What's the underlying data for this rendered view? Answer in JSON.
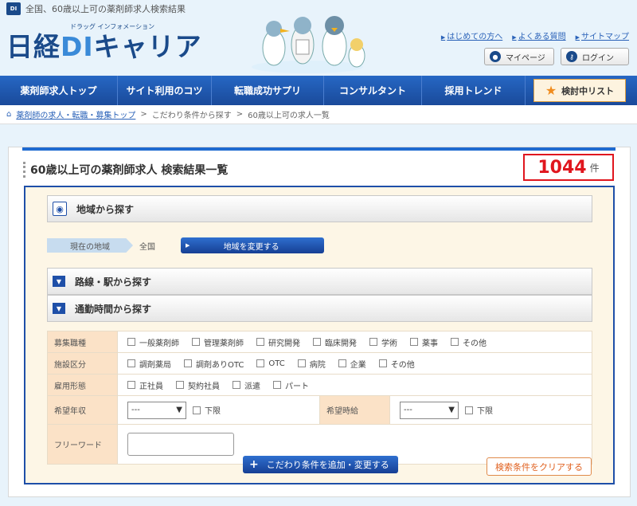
{
  "top": {
    "badge": "DI",
    "tagline": "全国、60歳以上可の薬剤師求人検索結果"
  },
  "brand": {
    "sub": "ドラッグ インフォメーション",
    "name_a": "日経",
    "name_b": "DI",
    "name_c": "キャリア"
  },
  "head_links": [
    "はじめての方へ",
    "よくある質問",
    "サイトマップ"
  ],
  "head_buttons": {
    "mypage": "マイページ",
    "login": "ログイン"
  },
  "nav": {
    "items": [
      "薬剤師求人トップ",
      "サイト利用のコツ",
      "転職成功サプリ",
      "コンサルタント",
      "採用トレンド"
    ],
    "favorites": "検討中リスト"
  },
  "breadcrumb": {
    "home": "薬剤師の求人・転職・募集トップ",
    "sep": ">",
    "step2": "こだわり条件から探す",
    "current": "60歳以上可の求人一覧"
  },
  "result": {
    "title": "60歳以上可の薬剤師求人 検索結果一覧",
    "count": "1044",
    "unit": "件"
  },
  "sections": {
    "region": "地域から探す",
    "route": "路線・駅から探す",
    "commute": "通勤時間から探す"
  },
  "region_row": {
    "label": "現在の地域",
    "value": "全国",
    "button": "地域を変更する"
  },
  "filters": {
    "job": {
      "label": "募集職種",
      "options": [
        "一般薬剤師",
        "管理薬剤師",
        "研究開発",
        "臨床開発",
        "学術",
        "薬事",
        "その他"
      ]
    },
    "facility": {
      "label": "施設区分",
      "options": [
        "調剤薬局",
        "調剤ありOTC",
        "OTC",
        "病院",
        "企業",
        "その他"
      ]
    },
    "employment": {
      "label": "雇用形態",
      "options": [
        "正社員",
        "契約社員",
        "派遣",
        "パート"
      ]
    },
    "salary": {
      "label": "希望年収",
      "select": "---",
      "lower": "下限"
    },
    "hourly": {
      "label": "希望時給",
      "select": "---",
      "lower": "下限"
    },
    "freeword": {
      "label": "フリーワード",
      "value": ""
    }
  },
  "buttons": {
    "add": "こだわり条件を追加・変更する",
    "clear": "検索条件をクリアする"
  },
  "colors": {
    "nav": "#1a4a9a",
    "accent": "#e0161e",
    "label_bg": "#fbe2c7"
  }
}
